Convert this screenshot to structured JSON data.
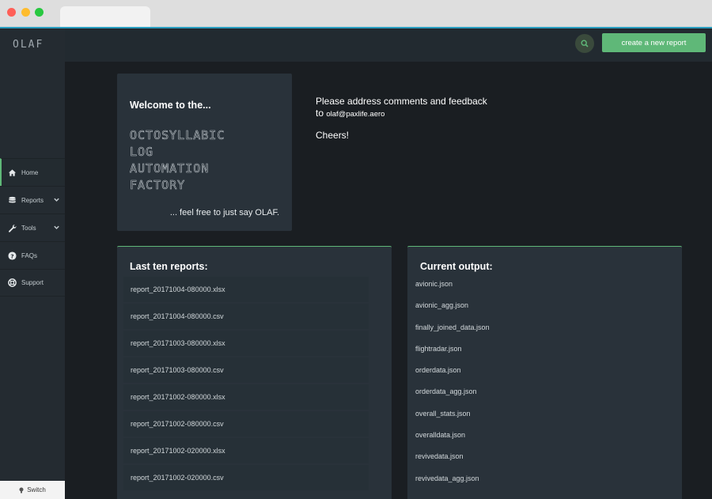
{
  "app": {
    "logo": "OLAF"
  },
  "sidebar": {
    "items": [
      {
        "label": "Home",
        "icon": "home-icon",
        "active": true
      },
      {
        "label": "Reports",
        "icon": "database-icon",
        "has_caret": true
      },
      {
        "label": "Tools",
        "icon": "wrench-icon",
        "has_caret": true
      },
      {
        "label": "FAQs",
        "icon": "question-icon"
      },
      {
        "label": "Support",
        "icon": "lifebuoy-icon"
      }
    ],
    "switch_label": "Switch"
  },
  "topbar": {
    "search_icon": "search-icon",
    "create_label": "create a new report"
  },
  "welcome": {
    "title": "Welcome to the...",
    "words": [
      "OCTOSYLLABIC",
      "LOG",
      "AUTOMATION",
      "FACTORY"
    ],
    "tagline": "... feel free to just say OLAF."
  },
  "feedback": {
    "line1": "Please address comments and feedback",
    "to": "to",
    "email": "olaf@paxlife.aero",
    "cheers": "Cheers!"
  },
  "reports": {
    "title": "Last ten reports:",
    "items": [
      "report_20171004-080000.xlsx",
      "report_20171004-080000.csv",
      "report_20171003-080000.xlsx",
      "report_20171003-080000.csv",
      "report_20171002-080000.xlsx",
      "report_20171002-080000.csv",
      "report_20171002-020000.xlsx",
      "report_20171002-020000.csv"
    ]
  },
  "output": {
    "title": "Current output:",
    "items": [
      "avionic.json",
      "avionic_agg.json",
      "finally_joined_data.json",
      "flightradar.json",
      "orderdata.json",
      "orderdata_agg.json",
      "overall_stats.json",
      "overalldata.json",
      "revivedata.json",
      "revivedata_agg.json"
    ]
  },
  "colors": {
    "accent": "#5fb878",
    "background": "#1a1e22",
    "panel": "#29323a"
  }
}
